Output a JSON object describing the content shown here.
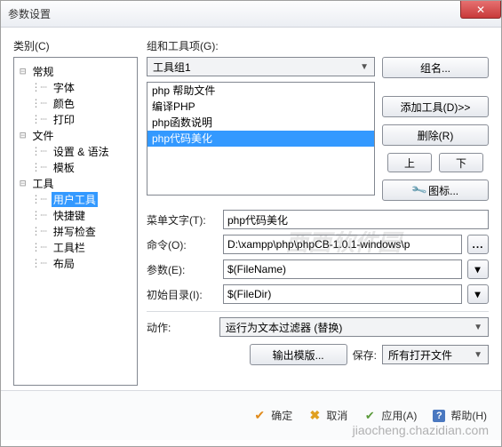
{
  "window": {
    "title": "参数设置"
  },
  "left": {
    "label": "类别(C)",
    "tree": [
      {
        "label": "常规",
        "depth": 0
      },
      {
        "label": "字体",
        "depth": 1
      },
      {
        "label": "颜色",
        "depth": 1
      },
      {
        "label": "打印",
        "depth": 1
      },
      {
        "label": "文件",
        "depth": 0
      },
      {
        "label": "设置 & 语法",
        "depth": 1
      },
      {
        "label": "模板",
        "depth": 1
      },
      {
        "label": "工具",
        "depth": 0
      },
      {
        "label": "用户工具",
        "depth": 1,
        "selected": true
      },
      {
        "label": "快捷键",
        "depth": 1
      },
      {
        "label": "拼写检查",
        "depth": 1
      },
      {
        "label": "工具栏",
        "depth": 1
      },
      {
        "label": "布局",
        "depth": 1
      }
    ]
  },
  "right": {
    "groups_label": "组和工具项(G):",
    "group_select": "工具组1",
    "items": [
      {
        "label": "php 帮助文件"
      },
      {
        "label": "编译PHP"
      },
      {
        "label": "php函数说明"
      },
      {
        "label": "php代码美化",
        "selected": true
      }
    ],
    "buttons": {
      "group_name": "组名...",
      "add_tool": "添加工具(D)>>",
      "delete": "删除(R)",
      "up": "上",
      "down": "下",
      "icon": "图标..."
    },
    "form": {
      "menu_text_label": "菜单文字(T):",
      "menu_text_value": "php代码美化",
      "command_label": "命令(O):",
      "command_value": "D:\\xampp\\php\\phpCB-1.0.1-windows\\p",
      "params_label": "参数(E):",
      "params_value": "$(FileName)",
      "initdir_label": "初始目录(I):",
      "initdir_value": "$(FileDir)",
      "action_label": "动作:",
      "action_value": "运行为文本过滤器 (替换)",
      "output_tpl": "输出模版...",
      "save_label": "保存:",
      "save_value": "所有打开文件"
    }
  },
  "footer": {
    "ok": "确定",
    "cancel": "取消",
    "apply": "应用(A)",
    "help": "帮助(H)"
  },
  "watermarks": {
    "wm1": "西西软件园",
    "wm2": "jiaocheng.chazidian.com"
  }
}
